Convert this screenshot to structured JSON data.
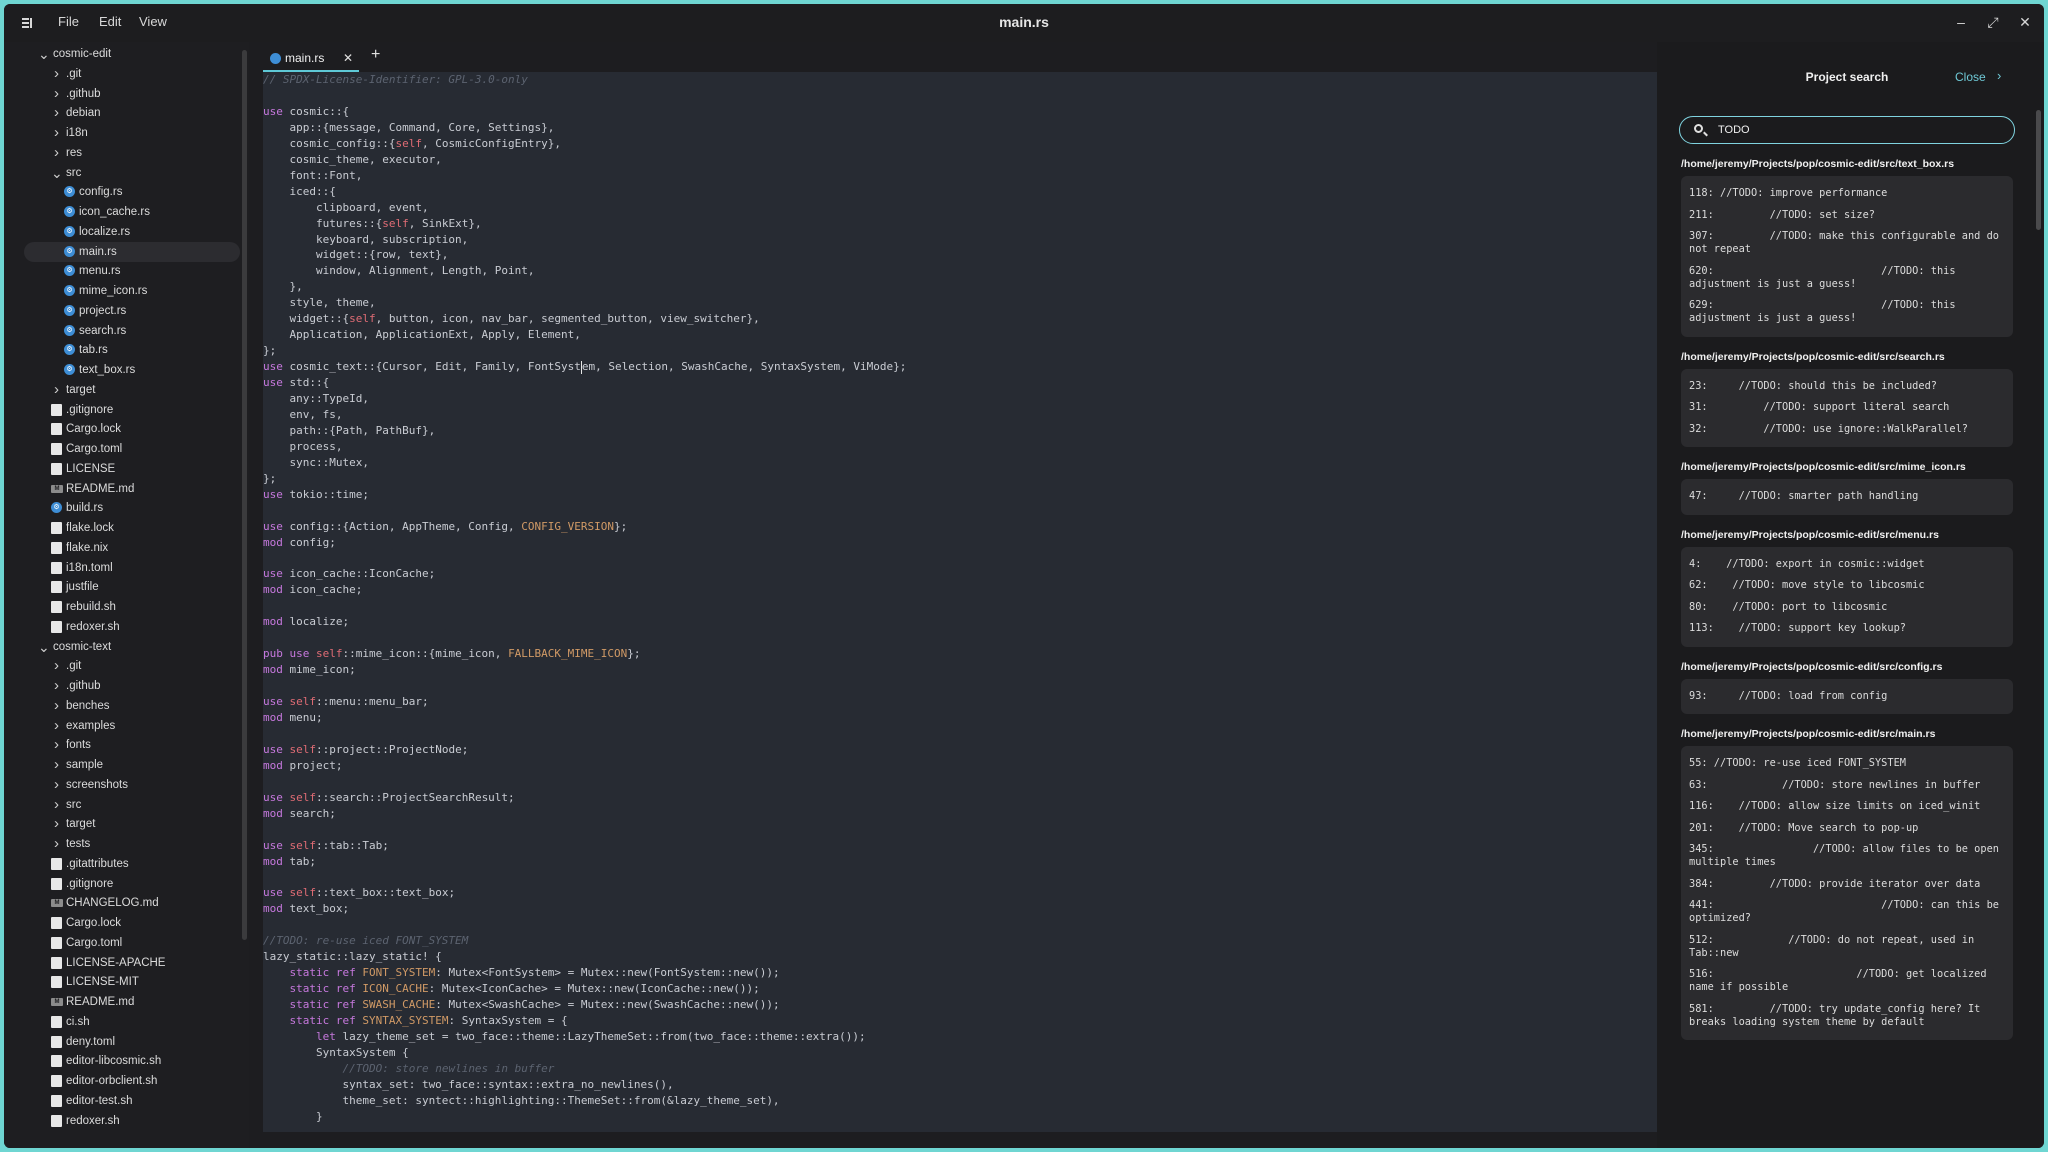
{
  "titlebar": {
    "title": "main.rs",
    "menus": [
      "File",
      "Edit",
      "View"
    ]
  },
  "sidebar": {
    "items": [
      {
        "label": "cosmic-edit",
        "kind": "dir-open",
        "depth": 0
      },
      {
        "label": ".git",
        "kind": "dir",
        "depth": 1
      },
      {
        "label": ".github",
        "kind": "dir",
        "depth": 1
      },
      {
        "label": "debian",
        "kind": "dir",
        "depth": 1
      },
      {
        "label": "i18n",
        "kind": "dir",
        "depth": 1
      },
      {
        "label": "res",
        "kind": "dir",
        "depth": 1
      },
      {
        "label": "src",
        "kind": "dir-open",
        "depth": 1
      },
      {
        "label": "config.rs",
        "kind": "rs",
        "depth": 2
      },
      {
        "label": "icon_cache.rs",
        "kind": "rs",
        "depth": 2
      },
      {
        "label": "localize.rs",
        "kind": "rs",
        "depth": 2
      },
      {
        "label": "main.rs",
        "kind": "rs",
        "depth": 2,
        "selected": true
      },
      {
        "label": "menu.rs",
        "kind": "rs",
        "depth": 2
      },
      {
        "label": "mime_icon.rs",
        "kind": "rs",
        "depth": 2
      },
      {
        "label": "project.rs",
        "kind": "rs",
        "depth": 2
      },
      {
        "label": "search.rs",
        "kind": "rs",
        "depth": 2
      },
      {
        "label": "tab.rs",
        "kind": "rs",
        "depth": 2
      },
      {
        "label": "text_box.rs",
        "kind": "rs",
        "depth": 2
      },
      {
        "label": "target",
        "kind": "dir",
        "depth": 1
      },
      {
        "label": ".gitignore",
        "kind": "file",
        "depth": 1
      },
      {
        "label": "Cargo.lock",
        "kind": "file",
        "depth": 1
      },
      {
        "label": "Cargo.toml",
        "kind": "file",
        "depth": 1
      },
      {
        "label": "LICENSE",
        "kind": "file",
        "depth": 1
      },
      {
        "label": "README.md",
        "kind": "md",
        "depth": 1
      },
      {
        "label": "build.rs",
        "kind": "rs",
        "depth": 1
      },
      {
        "label": "flake.lock",
        "kind": "file",
        "depth": 1
      },
      {
        "label": "flake.nix",
        "kind": "file",
        "depth": 1
      },
      {
        "label": "i18n.toml",
        "kind": "file",
        "depth": 1
      },
      {
        "label": "justfile",
        "kind": "file",
        "depth": 1
      },
      {
        "label": "rebuild.sh",
        "kind": "file",
        "depth": 1
      },
      {
        "label": "redoxer.sh",
        "kind": "file",
        "depth": 1
      },
      {
        "label": "cosmic-text",
        "kind": "dir-open",
        "depth": 0
      },
      {
        "label": ".git",
        "kind": "dir",
        "depth": 1
      },
      {
        "label": ".github",
        "kind": "dir",
        "depth": 1
      },
      {
        "label": "benches",
        "kind": "dir",
        "depth": 1
      },
      {
        "label": "examples",
        "kind": "dir",
        "depth": 1
      },
      {
        "label": "fonts",
        "kind": "dir",
        "depth": 1
      },
      {
        "label": "sample",
        "kind": "dir",
        "depth": 1
      },
      {
        "label": "screenshots",
        "kind": "dir",
        "depth": 1
      },
      {
        "label": "src",
        "kind": "dir",
        "depth": 1
      },
      {
        "label": "target",
        "kind": "dir",
        "depth": 1
      },
      {
        "label": "tests",
        "kind": "dir",
        "depth": 1
      },
      {
        "label": ".gitattributes",
        "kind": "file",
        "depth": 1
      },
      {
        "label": ".gitignore",
        "kind": "file",
        "depth": 1
      },
      {
        "label": "CHANGELOG.md",
        "kind": "md",
        "depth": 1
      },
      {
        "label": "Cargo.lock",
        "kind": "file",
        "depth": 1
      },
      {
        "label": "Cargo.toml",
        "kind": "file",
        "depth": 1
      },
      {
        "label": "LICENSE-APACHE",
        "kind": "file",
        "depth": 1
      },
      {
        "label": "LICENSE-MIT",
        "kind": "file",
        "depth": 1
      },
      {
        "label": "README.md",
        "kind": "md",
        "depth": 1
      },
      {
        "label": "ci.sh",
        "kind": "file",
        "depth": 1
      },
      {
        "label": "deny.toml",
        "kind": "file",
        "depth": 1
      },
      {
        "label": "editor-libcosmic.sh",
        "kind": "file",
        "depth": 1
      },
      {
        "label": "editor-orbclient.sh",
        "kind": "file",
        "depth": 1
      },
      {
        "label": "editor-test.sh",
        "kind": "file",
        "depth": 1
      },
      {
        "label": "redoxer.sh",
        "kind": "file",
        "depth": 1
      }
    ]
  },
  "tabs": [
    {
      "label": "main.rs",
      "close": "✕"
    }
  ],
  "tab_add": "+",
  "editor": {
    "lines": [
      [
        [
          "cmt",
          "// SPDX-License-Identifier: GPL-3.0-only"
        ]
      ],
      [],
      [
        [
          "kw",
          "use"
        ],
        [
          "",
          " cosmic::{"
        ]
      ],
      [
        [
          "",
          "    app::{message, Command, Core, Settings},"
        ]
      ],
      [
        [
          "",
          "    cosmic_config::{"
        ],
        [
          "slf",
          "self"
        ],
        [
          "",
          ", CosmicConfigEntry},"
        ]
      ],
      [
        [
          "",
          "    cosmic_theme, executor,"
        ]
      ],
      [
        [
          "",
          "    font::Font,"
        ]
      ],
      [
        [
          "",
          "    iced::{"
        ]
      ],
      [
        [
          "",
          "        clipboard, event,"
        ]
      ],
      [
        [
          "",
          "        futures::{"
        ],
        [
          "slf",
          "self"
        ],
        [
          "",
          ", SinkExt},"
        ]
      ],
      [
        [
          "",
          "        keyboard, subscription,"
        ]
      ],
      [
        [
          "",
          "        widget::{row, text},"
        ]
      ],
      [
        [
          "",
          "        window, Alignment, Length, Point,"
        ]
      ],
      [
        [
          "",
          "    },"
        ]
      ],
      [
        [
          "",
          "    style, theme,"
        ]
      ],
      [
        [
          "",
          "    widget::{"
        ],
        [
          "slf",
          "self"
        ],
        [
          "",
          ", button, icon, nav_bar, segmented_button, view_switcher},"
        ]
      ],
      [
        [
          "",
          "    Application, ApplicationExt, Apply, Element,"
        ]
      ],
      [
        [
          "",
          "};"
        ]
      ],
      [
        [
          "kw",
          "use"
        ],
        [
          "",
          " cosmic_text::{Cursor, Edit, Family, FontSyst"
        ],
        [
          "cursor",
          ""
        ],
        [
          "",
          "em, Selection, SwashCache, SyntaxSystem, ViMode};"
        ]
      ],
      [
        [
          "kw",
          "use"
        ],
        [
          "",
          " std::{"
        ]
      ],
      [
        [
          "",
          "    any::TypeId,"
        ]
      ],
      [
        [
          "",
          "    env, fs,"
        ]
      ],
      [
        [
          "",
          "    path::{Path, PathBuf},"
        ]
      ],
      [
        [
          "",
          "    process,"
        ]
      ],
      [
        [
          "",
          "    sync::Mutex,"
        ]
      ],
      [
        [
          "",
          "};"
        ]
      ],
      [
        [
          "kw",
          "use"
        ],
        [
          "",
          " tokio::time;"
        ]
      ],
      [],
      [
        [
          "kw",
          "use"
        ],
        [
          "",
          " config::{Action, AppTheme, Config, "
        ],
        [
          "cst",
          "CONFIG_VERSION"
        ],
        [
          "",
          "};"
        ]
      ],
      [
        [
          "kw",
          "mod"
        ],
        [
          "",
          " config;"
        ]
      ],
      [],
      [
        [
          "kw",
          "use"
        ],
        [
          "",
          " icon_cache::IconCache;"
        ]
      ],
      [
        [
          "kw",
          "mod"
        ],
        [
          "",
          " icon_cache;"
        ]
      ],
      [],
      [
        [
          "kw",
          "mod"
        ],
        [
          "",
          " localize;"
        ]
      ],
      [],
      [
        [
          "kw",
          "pub use"
        ],
        [
          "",
          " "
        ],
        [
          "slf",
          "self"
        ],
        [
          "",
          "::mime_icon::{mime_icon, "
        ],
        [
          "cst",
          "FALLBACK_MIME_ICON"
        ],
        [
          "",
          "};"
        ]
      ],
      [
        [
          "kw",
          "mod"
        ],
        [
          "",
          " mime_icon;"
        ]
      ],
      [],
      [
        [
          "kw",
          "use"
        ],
        [
          "",
          " "
        ],
        [
          "slf",
          "self"
        ],
        [
          "",
          "::menu::menu_bar;"
        ]
      ],
      [
        [
          "kw",
          "mod"
        ],
        [
          "",
          " menu;"
        ]
      ],
      [],
      [
        [
          "kw",
          "use"
        ],
        [
          "",
          " "
        ],
        [
          "slf",
          "self"
        ],
        [
          "",
          "::project::ProjectNode;"
        ]
      ],
      [
        [
          "kw",
          "mod"
        ],
        [
          "",
          " project;"
        ]
      ],
      [],
      [
        [
          "kw",
          "use"
        ],
        [
          "",
          " "
        ],
        [
          "slf",
          "self"
        ],
        [
          "",
          "::search::ProjectSearchResult;"
        ]
      ],
      [
        [
          "kw",
          "mod"
        ],
        [
          "",
          " search;"
        ]
      ],
      [],
      [
        [
          "kw",
          "use"
        ],
        [
          "",
          " "
        ],
        [
          "slf",
          "self"
        ],
        [
          "",
          "::tab::Tab;"
        ]
      ],
      [
        [
          "kw",
          "mod"
        ],
        [
          "",
          " tab;"
        ]
      ],
      [],
      [
        [
          "kw",
          "use"
        ],
        [
          "",
          " "
        ],
        [
          "slf",
          "self"
        ],
        [
          "",
          "::text_box::text_box;"
        ]
      ],
      [
        [
          "kw",
          "mod"
        ],
        [
          "",
          " text_box;"
        ]
      ],
      [],
      [
        [
          "cmt",
          "//TODO: re-use iced FONT_SYSTEM"
        ]
      ],
      [
        [
          "",
          "lazy_static::lazy_static! {"
        ]
      ],
      [
        [
          "",
          "    "
        ],
        [
          "kw",
          "static ref"
        ],
        [
          "",
          " "
        ],
        [
          "cst",
          "FONT_SYSTEM"
        ],
        [
          "",
          ": Mutex<FontSystem> = Mutex::new(FontSystem::new());"
        ]
      ],
      [
        [
          "",
          "    "
        ],
        [
          "kw",
          "static ref"
        ],
        [
          "",
          " "
        ],
        [
          "cst",
          "ICON_CACHE"
        ],
        [
          "",
          ": Mutex<IconCache> = Mutex::new(IconCache::new());"
        ]
      ],
      [
        [
          "",
          "    "
        ],
        [
          "kw",
          "static ref"
        ],
        [
          "",
          " "
        ],
        [
          "cst",
          "SWASH_CACHE"
        ],
        [
          "",
          ": Mutex<SwashCache> = Mutex::new(SwashCache::new());"
        ]
      ],
      [
        [
          "",
          "    "
        ],
        [
          "kw",
          "static ref"
        ],
        [
          "",
          " "
        ],
        [
          "cst",
          "SYNTAX_SYSTEM"
        ],
        [
          "",
          ": SyntaxSystem = {"
        ]
      ],
      [
        [
          "",
          "        "
        ],
        [
          "kw",
          "let"
        ],
        [
          "",
          " lazy_theme_set = two_face::theme::LazyThemeSet::from(two_face::theme::extra());"
        ]
      ],
      [
        [
          "",
          "        SyntaxSystem {"
        ]
      ],
      [
        [
          "",
          "            "
        ],
        [
          "cmt",
          "//TODO: store newlines in buffer"
        ]
      ],
      [
        [
          "",
          "            syntax_set: two_face::syntax::extra_no_newlines(),"
        ]
      ],
      [
        [
          "",
          "            theme_set: syntect::highlighting::ThemeSet::from(&lazy_theme_set),"
        ]
      ],
      [
        [
          "",
          "        }"
        ]
      ]
    ]
  },
  "search_panel": {
    "title": "Project search",
    "close_label": "Close",
    "query": "TODO",
    "results": [
      {
        "path": "/home/jeremy/Projects/pop/cosmic-edit/src/text_box.rs",
        "lines": [
          "118: //TODO: improve performance",
          "211:         //TODO: set size?",
          "307:         //TODO: make this configurable and do not repeat",
          "620:                           //TODO: this adjustment is just a guess!",
          "629:                           //TODO: this adjustment is just a guess!"
        ]
      },
      {
        "path": "/home/jeremy/Projects/pop/cosmic-edit/src/search.rs",
        "lines": [
          "23:     //TODO: should this be included?",
          "31:         //TODO: support literal search",
          "32:         //TODO: use ignore::WalkParallel?"
        ]
      },
      {
        "path": "/home/jeremy/Projects/pop/cosmic-edit/src/mime_icon.rs",
        "lines": [
          "47:     //TODO: smarter path handling"
        ]
      },
      {
        "path": "/home/jeremy/Projects/pop/cosmic-edit/src/menu.rs",
        "lines": [
          "4:    //TODO: export in cosmic::widget",
          "62:    //TODO: move style to libcosmic",
          "80:    //TODO: port to libcosmic",
          "113:    //TODO: support key lookup?"
        ]
      },
      {
        "path": "/home/jeremy/Projects/pop/cosmic-edit/src/config.rs",
        "lines": [
          "93:     //TODO: load from config"
        ]
      },
      {
        "path": "/home/jeremy/Projects/pop/cosmic-edit/src/main.rs",
        "lines": [
          "55: //TODO: re-use iced FONT_SYSTEM",
          "63:            //TODO: store newlines in buffer",
          "116:    //TODO: allow size limits on iced_winit",
          "201:    //TODO: Move search to pop-up",
          "345:                //TODO: allow files to be open multiple times",
          "384:         //TODO: provide iterator over data",
          "441:                           //TODO: can this be optimized?",
          "512:            //TODO: do not repeat, used in Tab::new",
          "516:                       //TODO: get localized name if possible",
          "581:         //TODO: try update_config here? It breaks loading system theme by default"
        ]
      }
    ]
  }
}
